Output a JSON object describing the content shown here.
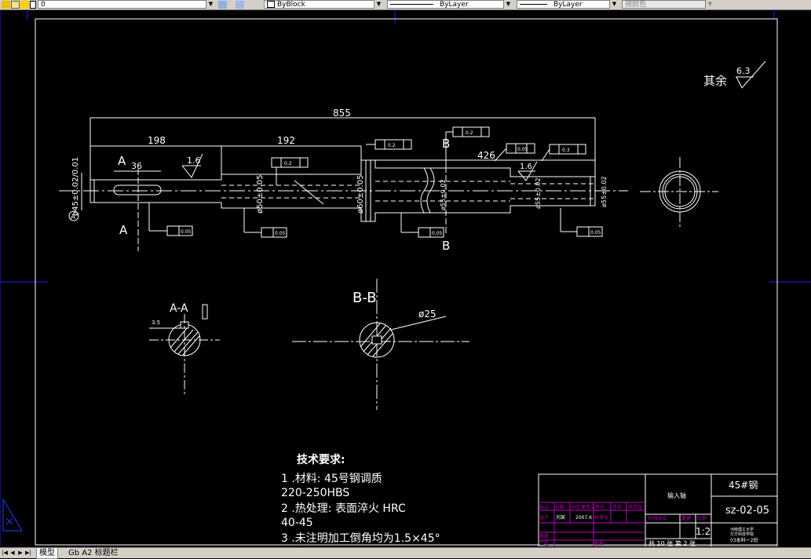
{
  "toolbar": {
    "layer_value": "0",
    "color_value": "ByBlock",
    "linetype_value": "ByLayer",
    "lineweight_value": "ByLayer",
    "plotstyle_value": "随颜色"
  },
  "tabs": [
    {
      "label": "模型"
    },
    {
      "label": "Gb A2 标题栏"
    }
  ],
  "drawing": {
    "roughness_label": "其余",
    "roughness_value": "6.3",
    "dim_overall": "855",
    "dim_198": "198",
    "dim_192": "192",
    "dim_426": "426",
    "dim_36": "36",
    "rough_1_6_a": "1.6",
    "rough_1_6_b": "1.6",
    "dia_45": "ø45±0.02/0.01",
    "dia_50": "ø50±0.05",
    "dia_60": "ø60±0.05",
    "dia_55_a": "ø55±0.02",
    "dia_55_b": "ø55±0.02",
    "dia_55_c": "ø55±0.02",
    "datum_a": "A",
    "section_a_left": "A",
    "section_a_left2": "A",
    "section_b_top": "B",
    "section_b_bottom": "B",
    "tol_005": "0.05",
    "tol_02": "0.2",
    "tol_03": "0.3",
    "section_aa_title": "A-A",
    "section_bb_title": "B-B",
    "keyway_width": "3.5",
    "dia_25": "ø25"
  },
  "tech": {
    "title": "技术要求:",
    "line1": "1 .材料: 45号钢调质",
    "line2": "220-250HBS",
    "line3": "2 .热处理: 表面淬火 HRC",
    "line4": "40-45",
    "line5": "3 .未注明加工倒角均为1.5×45°"
  },
  "title_block": {
    "part_name": "输入轴",
    "material": "45#钢",
    "drawing_no": "sz-02-05",
    "scale": "1:2",
    "sheet_info": "共 10  张 第 2 张",
    "hdr_mark": "标记",
    "hdr_count": "处数",
    "hdr_zone": "分区",
    "hdr_change": "更改文件号",
    "hdr_sign": "签名",
    "hdr_date": "年月日",
    "design": "设计",
    "designer": "刘某",
    "date": "2007.6",
    "standard": "标准化",
    "stage": "阶段标记",
    "weight": "重量",
    "ratio": "比例",
    "review": "审核",
    "process": "工艺",
    "approve": "批准",
    "school1": "河南理工大学",
    "school2": "万方科技学院",
    "class": "03本科一2班"
  }
}
